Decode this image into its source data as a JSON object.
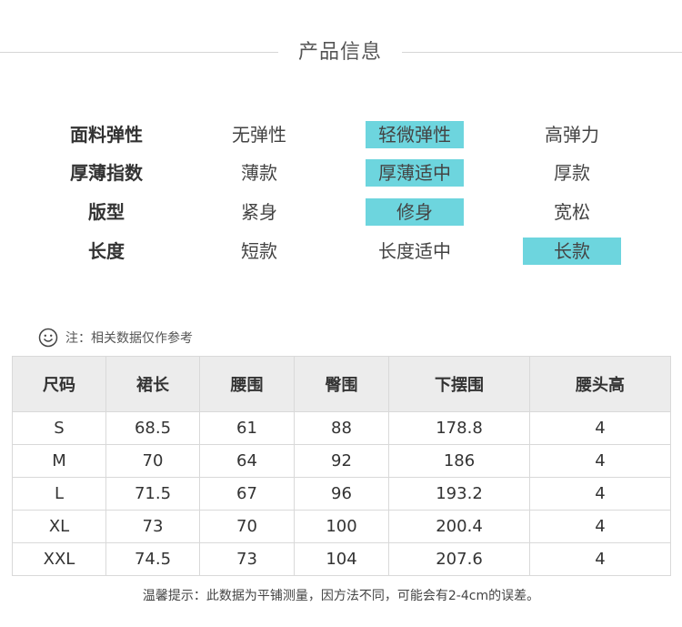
{
  "title": "产品信息",
  "attributes": [
    {
      "label": "面料弹性",
      "options": [
        "无弹性",
        "轻微弹性",
        "高弹力"
      ],
      "selected": 1
    },
    {
      "label": "厚薄指数",
      "options": [
        "薄款",
        "厚薄适中",
        "厚款"
      ],
      "selected": 1
    },
    {
      "label": "版型",
      "options": [
        "紧身",
        "修身",
        "宽松"
      ],
      "selected": 1
    },
    {
      "label": "长度",
      "options": [
        "短款",
        "长度适中",
        "长款"
      ],
      "selected": 2
    }
  ],
  "highlight_color": "#6dd5de",
  "note": {
    "icon": "smile-icon",
    "text": "注：相关数据仅作参考"
  },
  "size_table": {
    "headers": [
      "尺码",
      "裙长",
      "腰围",
      "臀围",
      "下摆围",
      "腰头高"
    ],
    "rows": [
      [
        "S",
        "68.5",
        "61",
        "88",
        "178.8",
        "4"
      ],
      [
        "M",
        "70",
        "64",
        "92",
        "186",
        "4"
      ],
      [
        "L",
        "71.5",
        "67",
        "96",
        "193.2",
        "4"
      ],
      [
        "XL",
        "73",
        "70",
        "100",
        "200.4",
        "4"
      ],
      [
        "XXL",
        "74.5",
        "73",
        "104",
        "207.6",
        "4"
      ]
    ]
  },
  "footer": "温馨提示：此数据为平铺测量，因方法不同，可能会有2-4cm的误差。"
}
